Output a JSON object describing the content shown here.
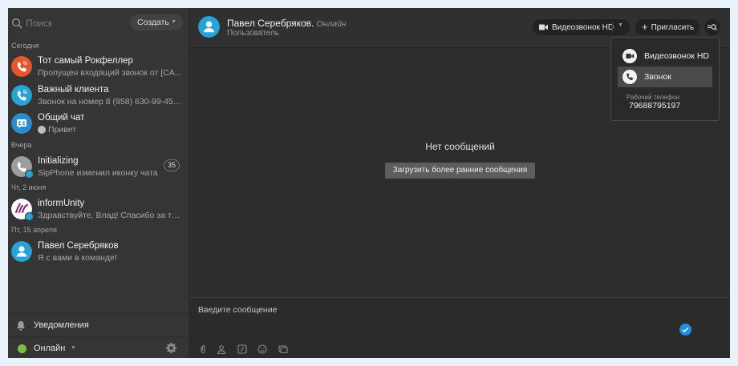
{
  "sidebar": {
    "search_placeholder": "Поиск",
    "create_label": "Создать",
    "groups": {
      "today": "Сегодня",
      "yesterday": "Вчера",
      "thu_jun2": "Чт, 2 июня",
      "fri_apr15": "Пт, 15 апреля"
    },
    "chats": [
      {
        "title": "Тот самый Рокфеллер",
        "subtitle": "Пропущен входящий звонок от [CA..."
      },
      {
        "title": "Важный клиента",
        "subtitle": "Звонок на номер 8 (958) 630-99-45 ..."
      },
      {
        "title": "Общий чат",
        "subtitle": "Привет"
      },
      {
        "title": "Initializing",
        "subtitle": "SipPhone изменил иконку чата",
        "count": "35"
      },
      {
        "title": "informUnity",
        "subtitle": "Здравствуйте, Влад! Спасибо за то..."
      },
      {
        "title": "Павел Серебряков",
        "subtitle": "Я с вами в команде!"
      }
    ],
    "notifications_label": "Уведомления",
    "status_label": "Онлайн"
  },
  "header": {
    "name": "Павел Серебряков.",
    "presence": "Онлайн",
    "role": "Пользователь",
    "video_call_label": "Видеозвонок HD",
    "invite_label": "Пригласить"
  },
  "main": {
    "empty_text": "Нет сообщений",
    "load_earlier_label": "Загрузить более ранние сообщения",
    "compose_placeholder": "Введите сообщение"
  },
  "dropdown": {
    "video_call_label": "Видеозвонок HD",
    "call_label": "Звонок",
    "phone_caption": "Рабочий телефон",
    "phone_number": "79688795197"
  },
  "colors": {
    "accent_blue": "#1e90dd",
    "status_online": "#7cc042",
    "missed_call": "#e8552a",
    "call_teal": "#27a3d8"
  }
}
